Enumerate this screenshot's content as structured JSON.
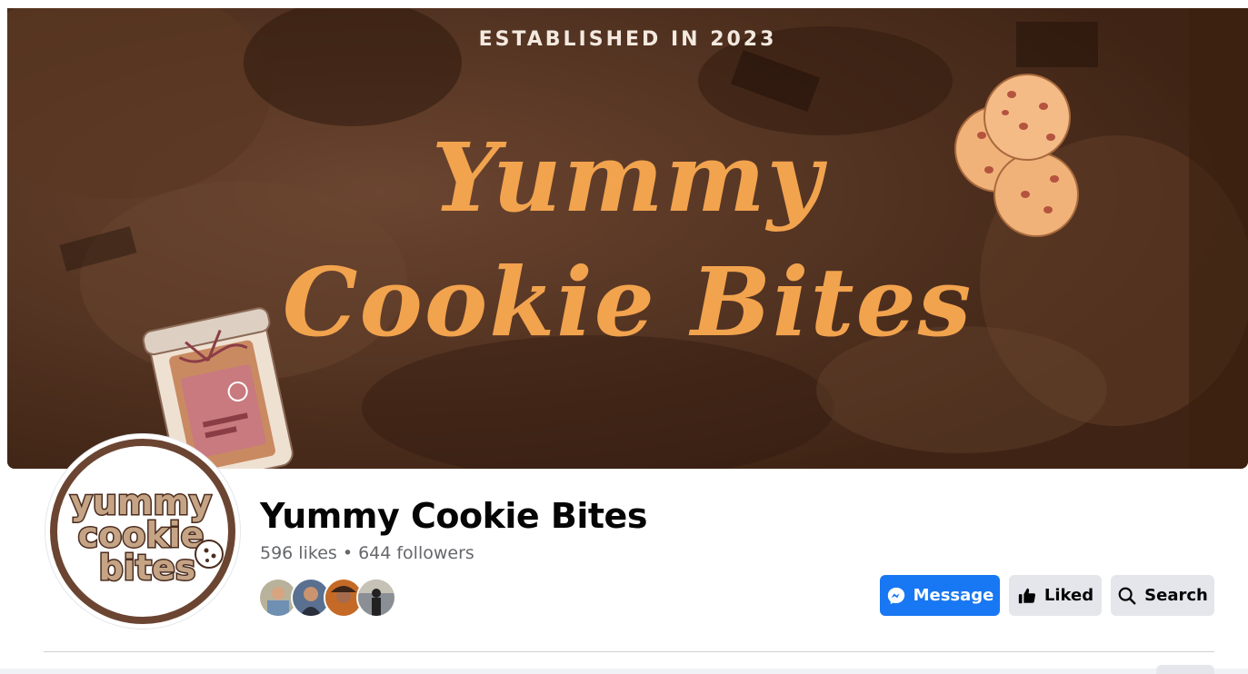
{
  "cover": {
    "tagline": "ESTABLISHED IN 2023",
    "title_line1": "Yummy",
    "title_line2": "Cookie Bites"
  },
  "profile": {
    "avatar_text": [
      "yummy",
      "cookie",
      "bites"
    ],
    "name": "Yummy Cookie Bites",
    "stats": "596 likes • 644 followers",
    "friend_avatars": [
      "friend-1",
      "friend-2",
      "friend-3",
      "friend-4"
    ]
  },
  "actions": {
    "message_label": "Message",
    "liked_label": "Liked",
    "search_label": "Search"
  },
  "colors": {
    "primary": "#1877f2",
    "secondary_button": "#e4e6eb",
    "cover_brown": "#4a2c1a",
    "cover_orange": "#f2a34e"
  }
}
